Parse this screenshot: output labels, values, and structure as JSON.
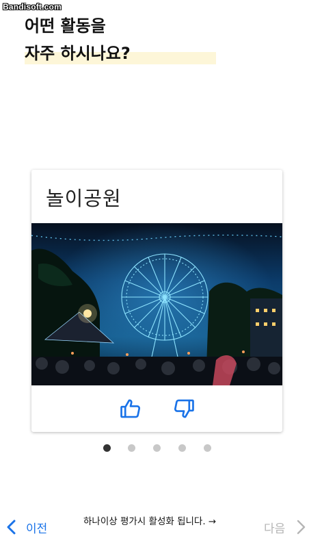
{
  "watermark": "Bandisoft.com",
  "question": {
    "line1": "어떤 활동을",
    "line2": "자주 하시나요?"
  },
  "card": {
    "title": "놀이공원",
    "image_subject": "ferris-wheel-night-amusement-park",
    "like_icon": "thumbs-up-icon",
    "dislike_icon": "thumbs-down-icon",
    "accent_color": "#1a73e8"
  },
  "pagination": {
    "count": 5,
    "active_index": 0
  },
  "nav": {
    "prev_label": "이전",
    "hint": "하나이상 평가시 활성화 됩니다. →",
    "next_label": "다음",
    "next_enabled": false
  }
}
